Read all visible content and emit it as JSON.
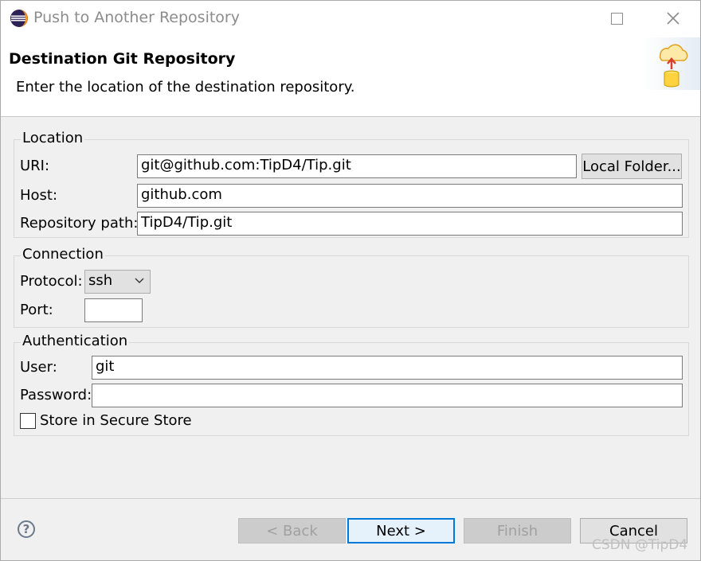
{
  "window": {
    "title": "Push to Another Repository"
  },
  "header": {
    "title": "Destination Git Repository",
    "description": "Enter the location of the destination repository."
  },
  "location": {
    "group_label": "Location",
    "uri_label": "URI:",
    "uri_value": "git@github.com:TipD4/Tip.git",
    "local_folder_label": "Local Folder...",
    "host_label": "Host:",
    "host_value": "github.com",
    "repo_path_label": "Repository path:",
    "repo_path_value": "TipD4/Tip.git"
  },
  "connection": {
    "group_label": "Connection",
    "protocol_label": "Protocol:",
    "protocol_value": "ssh",
    "port_label": "Port:",
    "port_value": ""
  },
  "authentication": {
    "group_label": "Authentication",
    "user_label": "User:",
    "user_value": "git",
    "password_label": "Password:",
    "password_value": "",
    "secure_store_label": "Store in Secure Store",
    "secure_store_checked": false
  },
  "footer": {
    "back_label": "< Back",
    "next_label": "Next >",
    "finish_label": "Finish",
    "cancel_label": "Cancel"
  },
  "watermark": "CSDN @TipD4",
  "colors": {
    "accent": "#0078d7",
    "disabled_text": "#a0a0a0"
  }
}
